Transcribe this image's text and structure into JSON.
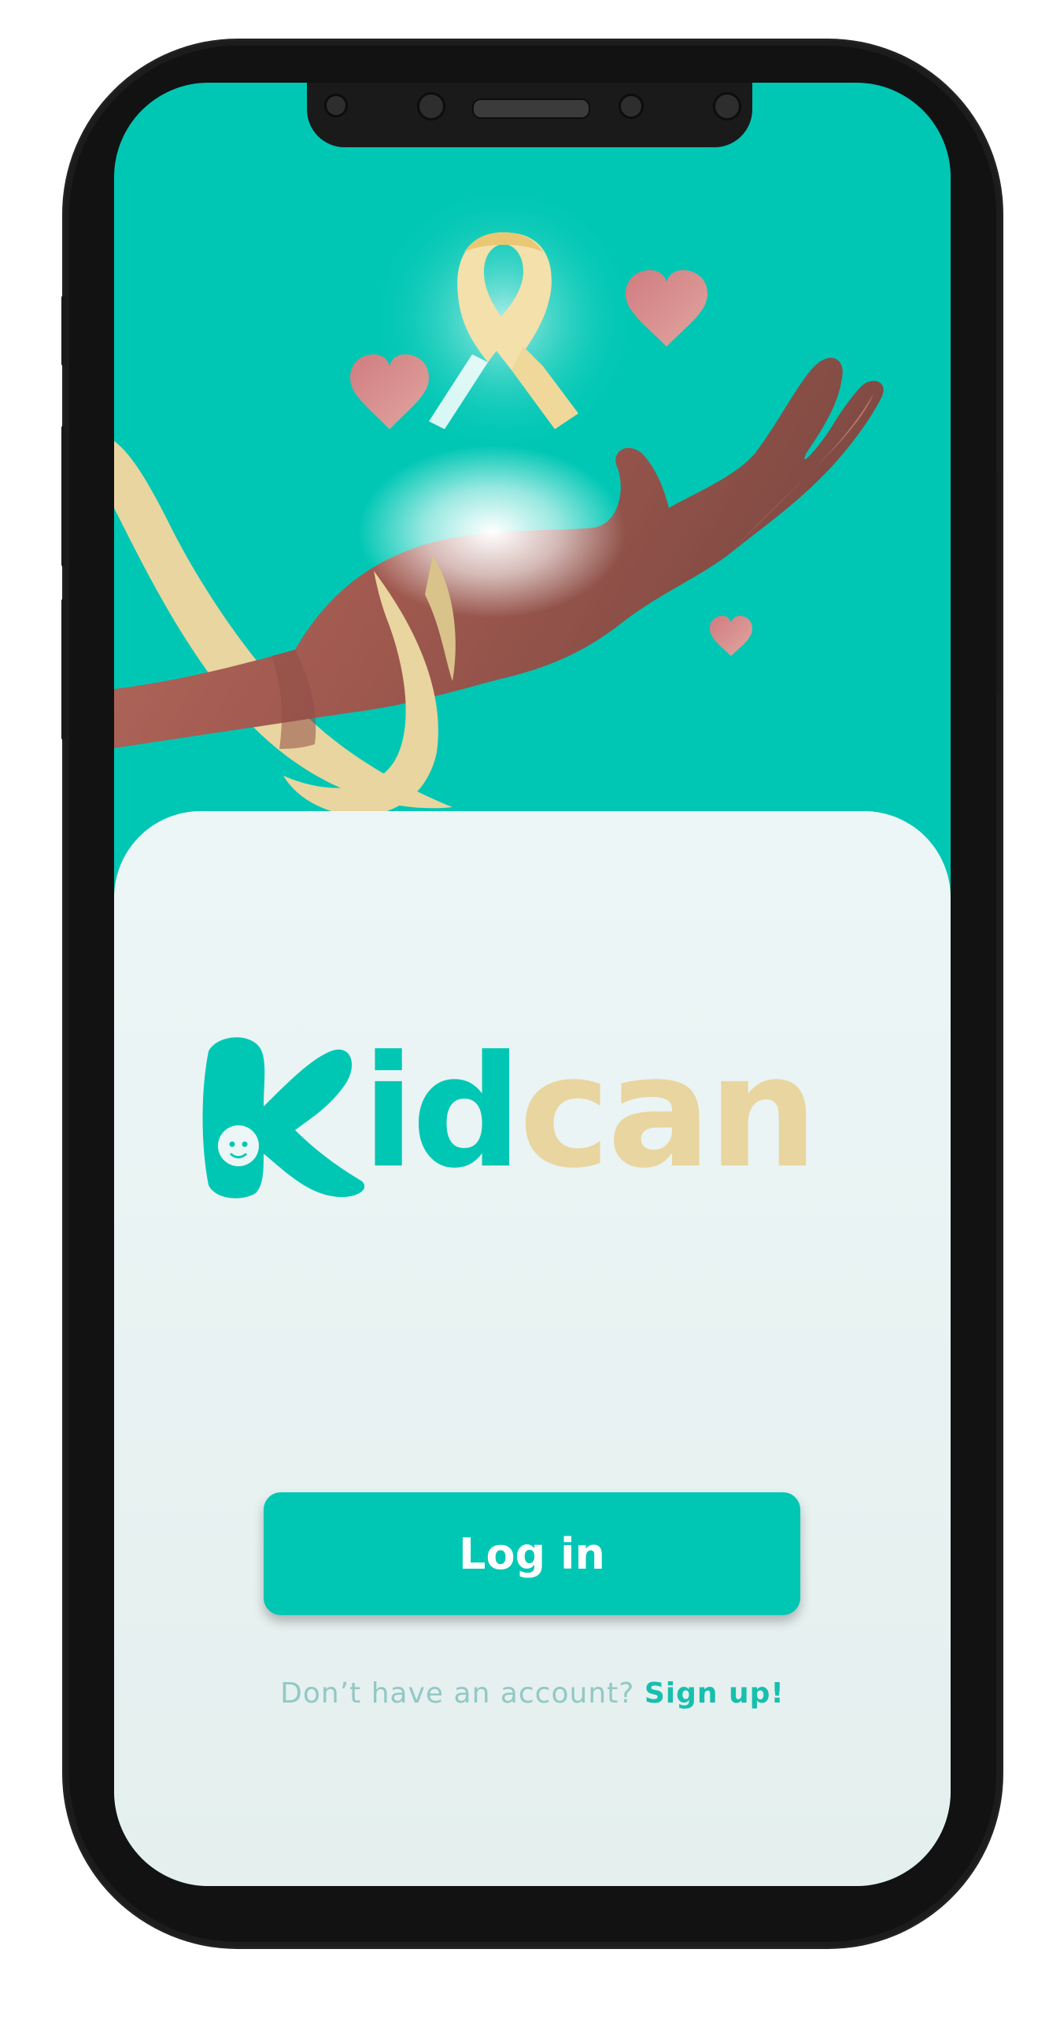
{
  "app": {
    "name_part1": "Kid",
    "name_part2": "can"
  },
  "auth": {
    "login_label": "Log in",
    "signup_prompt": "Don’t have an account?",
    "signup_link": "Sign up!"
  },
  "colors": {
    "brand_teal": "#00c7b4",
    "brand_sand": "#e9d59f",
    "card_background": "#ecf6f6",
    "heart_pink": "#d99090"
  },
  "icons": {
    "mascot": "antenna-bug-icon",
    "ribbon": "awareness-ribbon-icon",
    "hearts": "heart-icon"
  }
}
